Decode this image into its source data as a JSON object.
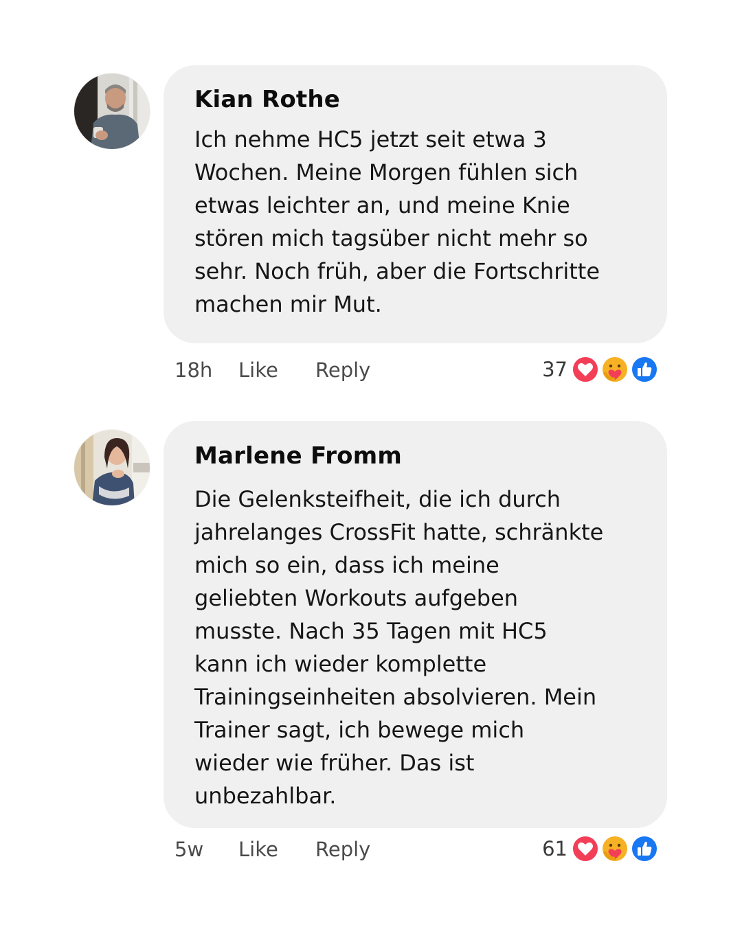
{
  "comments": [
    {
      "author": "Kian Rothe",
      "text": "Ich nehme HC5 jetzt seit etwa 3\nWochen. Meine Morgen fühlen sich\netwas leichter an, und meine Knie\nstören mich tagsüber nicht mehr so\nsehr. Noch früh, aber die Fortschritte\nmachen mir Mut.",
      "time": "18h",
      "like_label": "Like",
      "reply_label": "Reply",
      "reaction_count": "37",
      "reactions": [
        "heart-icon",
        "care-icon",
        "thumbs-up-icon"
      ]
    },
    {
      "author": "Marlene Fromm",
      "text": "Die Gelenksteifheit, die ich durch\njahrelanges CrossFit hatte, schränkte\nmich so ein, dass ich meine\ngeliebten Workouts aufgeben\nmusste. Nach 35 Tagen mit HC5\nkann ich wieder komplette\nTrainingseinheiten absolvieren. Mein\nTrainer sagt, ich bewege mich\nwieder wie früher. Das ist\nunbezahlbar.",
      "time": "5w",
      "like_label": "Like",
      "reply_label": "Reply",
      "reaction_count": "61",
      "reactions": [
        "heart-icon",
        "care-icon",
        "thumbs-up-icon"
      ]
    }
  ],
  "colors": {
    "bubble": "#f0f0f0",
    "meta_text": "#4a4a4a",
    "heart": "#f33e58",
    "care": "#f7b125",
    "like_blue": "#1877f2"
  }
}
